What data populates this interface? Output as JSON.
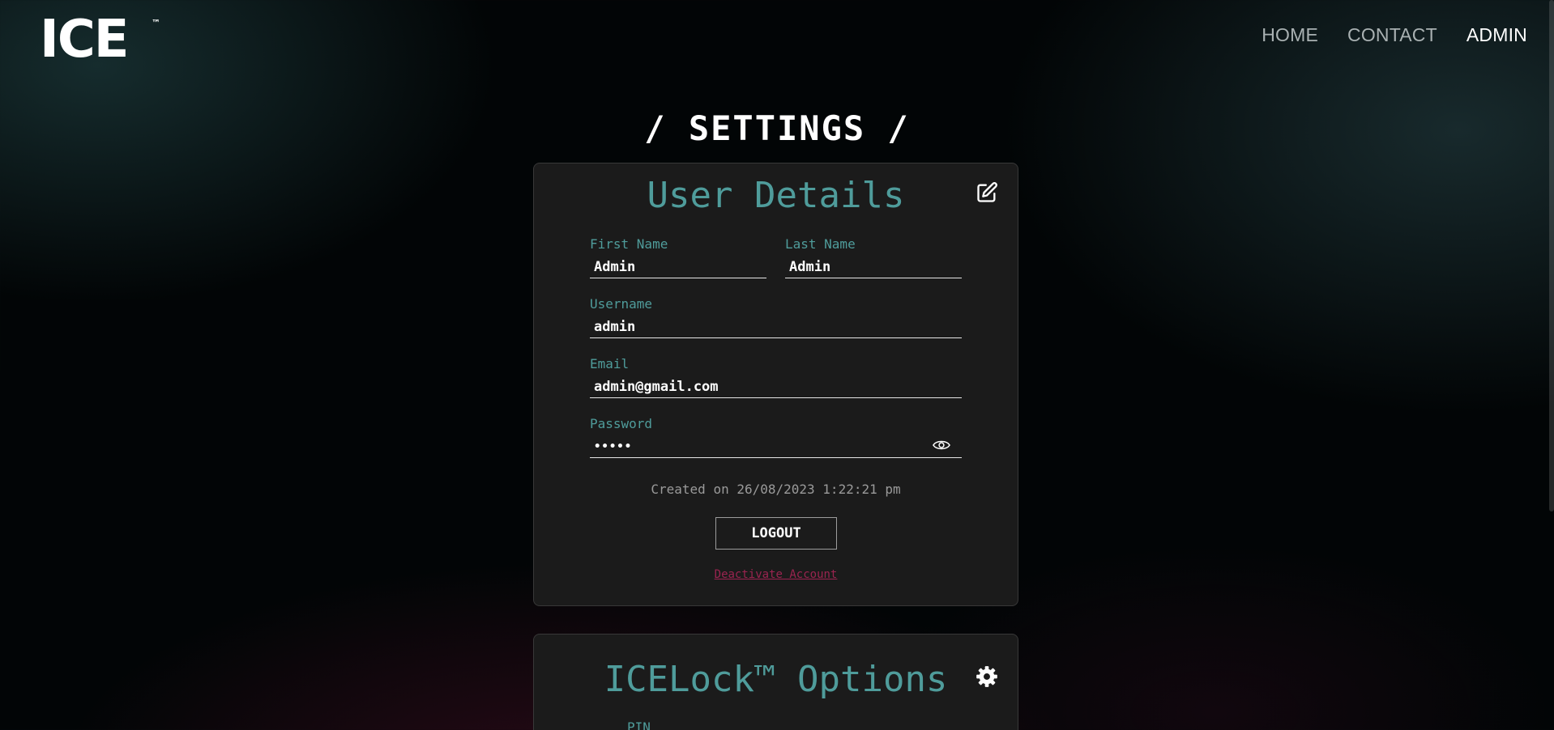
{
  "header": {
    "logo_text": "ICE™",
    "nav": [
      {
        "label": "HOME",
        "active": false
      },
      {
        "label": "CONTACT",
        "active": false
      },
      {
        "label": "ADMIN",
        "active": true
      }
    ]
  },
  "page": {
    "title": "/ SETTINGS /"
  },
  "user_details": {
    "title": "User Details",
    "edit_icon": "edit-icon",
    "first_name": {
      "label": "First Name",
      "value": "Admin"
    },
    "last_name": {
      "label": "Last Name",
      "value": "Admin"
    },
    "username": {
      "label": "Username",
      "value": "admin"
    },
    "email": {
      "label": "Email",
      "value": "admin@gmail.com"
    },
    "password": {
      "label": "Password",
      "value": "•••••",
      "toggle_icon": "eye-icon"
    },
    "created": "Created on 26/08/2023 1:22:21 pm",
    "logout_label": "LOGOUT",
    "deactivate_label": "Deactivate Account"
  },
  "icelock": {
    "title": "ICELock™ Options",
    "settings_icon": "gear-icon",
    "pin_label": "PIN"
  },
  "colors": {
    "accent": "#4f9c9b",
    "card_bg": "#1b1b1b",
    "danger": "#9b2450"
  }
}
